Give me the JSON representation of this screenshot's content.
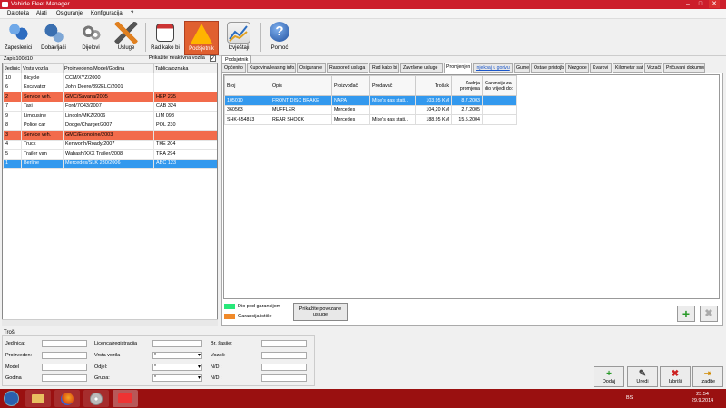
{
  "window": {
    "title": "Vehicle Fleet Manager",
    "minimize": "–",
    "maximize": "□",
    "close": "✕"
  },
  "menu": [
    "Datoteka",
    "Alati",
    "Osiguranje",
    "Konfiguracija",
    "?"
  ],
  "toolbar": [
    {
      "label": "Zaposlenici",
      "icon": "employees-icon"
    },
    {
      "label": "Dobavljači",
      "icon": "suppliers-icon"
    },
    {
      "label": "Dijelovi",
      "icon": "parts-gears-icon"
    },
    {
      "label": "Usluge",
      "icon": "tools-icon"
    },
    {
      "label": "Rad kako bi",
      "icon": "calendar-icon"
    },
    {
      "label": "Podsjetnik",
      "icon": "warning-icon"
    },
    {
      "label": "Izvještaji",
      "icon": "chart-icon"
    },
    {
      "label": "Pomoć",
      "icon": "help-icon"
    }
  ],
  "left": {
    "record_count": "Zapis100d10",
    "show_inactive_label": "Prikažite neaktivna vozila",
    "show_inactive_checked": "✓",
    "columns": [
      "Jedinic",
      "Vrsta vozila",
      "Proizvedeno/Model/Godina",
      "Tablica/oznaka"
    ],
    "rows": [
      {
        "c": [
          "10",
          "Bicycle",
          "CCM/XYZ/2000",
          ""
        ],
        "s": ""
      },
      {
        "c": [
          "6",
          "Excavator",
          "John Deere/892ELC/2001",
          ""
        ],
        "s": ""
      },
      {
        "c": [
          "2",
          "Service veh.",
          "GMC/Savana/2005",
          "HEP 235"
        ],
        "s": "svc"
      },
      {
        "c": [
          "7",
          "Taxi",
          "Ford/7C43/2007",
          "CAB 324"
        ],
        "s": ""
      },
      {
        "c": [
          "9",
          "Limousine",
          "Lincoln/MKZ/2006",
          "LIM 098"
        ],
        "s": ""
      },
      {
        "c": [
          "8",
          "Police car",
          "Dodge/Charger/2007",
          "POL 230"
        ],
        "s": ""
      },
      {
        "c": [
          "3",
          "Service veh.",
          "GMC/Econoline/2003",
          ""
        ],
        "s": "svc"
      },
      {
        "c": [
          "4",
          "Truck",
          "Kenworth/Roady/2007",
          "TKE 204"
        ],
        "s": ""
      },
      {
        "c": [
          "5",
          "Trailer van",
          "Wabash/XXX Trailer/2008",
          "TRA 294"
        ],
        "s": ""
      },
      {
        "c": [
          "1",
          "Berline",
          "Mercedes/SLK 230/2006",
          "ABC 123"
        ],
        "s": "sel"
      }
    ]
  },
  "right": {
    "top_tab": "Podsjetnik",
    "tabs": [
      "Općenito",
      "Kupovina/leasing info.",
      "Osiguranje",
      "Raspored usluga",
      "Rad kako bi",
      "Završene usluge",
      "Promjenjen",
      "Injekbaj u gorivu",
      "Gume",
      "Ostale pristojbe",
      "Nezgode",
      "Kvarovi",
      "Kilometar sat",
      "Vozači",
      "Pričuvani dokumenti"
    ],
    "active_tab": 6,
    "columns": [
      "Broj",
      "Opis",
      "Proizvođač",
      "Prodavač",
      "Trošak",
      "Zadnja promjena",
      "Garancija za dio vrijedi do:"
    ],
    "rows": [
      {
        "c": [
          "105010",
          "FRONT DISC BRAKE",
          "NAPA",
          "Mike's gas stati...",
          "103,95 KM",
          "8.7.2003",
          ""
        ],
        "s": "sel"
      },
      {
        "c": [
          "360563",
          "MUFFLER",
          "Mercedes",
          "",
          "104,20 KM",
          "2.7.2005",
          ""
        ],
        "s": ""
      },
      {
        "c": [
          "SHK-654813",
          "REAR SHOCK",
          "Mercedes",
          "Mike's gas stati...",
          "188,95 KM",
          "15.5.2004",
          ""
        ],
        "s": ""
      }
    ],
    "legend_warranty": "Dio pod garancijom",
    "legend_expiring": "Garancija ističe",
    "linked_services_button": "Prikažite povezane usluge",
    "add": "+",
    "remove": "✖"
  },
  "costs": {
    "title": "Troš",
    "fields_col1": [
      "Jedinica:",
      "Proizveden:",
      "Model",
      "Godina"
    ],
    "fields_col2": [
      "Licenca/registracija",
      "Vrsta vozila",
      "Odjel:",
      "Grupa:"
    ],
    "fields_col3": [
      "Br. šasije:",
      "Vozač:",
      "N/D :",
      "N/D :"
    ],
    "select_value": "*"
  },
  "actions": [
    {
      "label": "Dodaj",
      "glyph": "+",
      "icon": "add-icon",
      "color": "#2a9a2a"
    },
    {
      "label": "Uredi",
      "glyph": "✎",
      "icon": "edit-icon",
      "color": "#444444"
    },
    {
      "label": "Izbriši",
      "glyph": "✖",
      "icon": "delete-icon",
      "color": "#cc2020"
    },
    {
      "label": "Izađite",
      "glyph": "⇥",
      "icon": "exit-icon",
      "color": "#d08a00"
    }
  ],
  "taskbar": {
    "lang": "BS",
    "time": "23:54",
    "date": "29.9.2014"
  }
}
